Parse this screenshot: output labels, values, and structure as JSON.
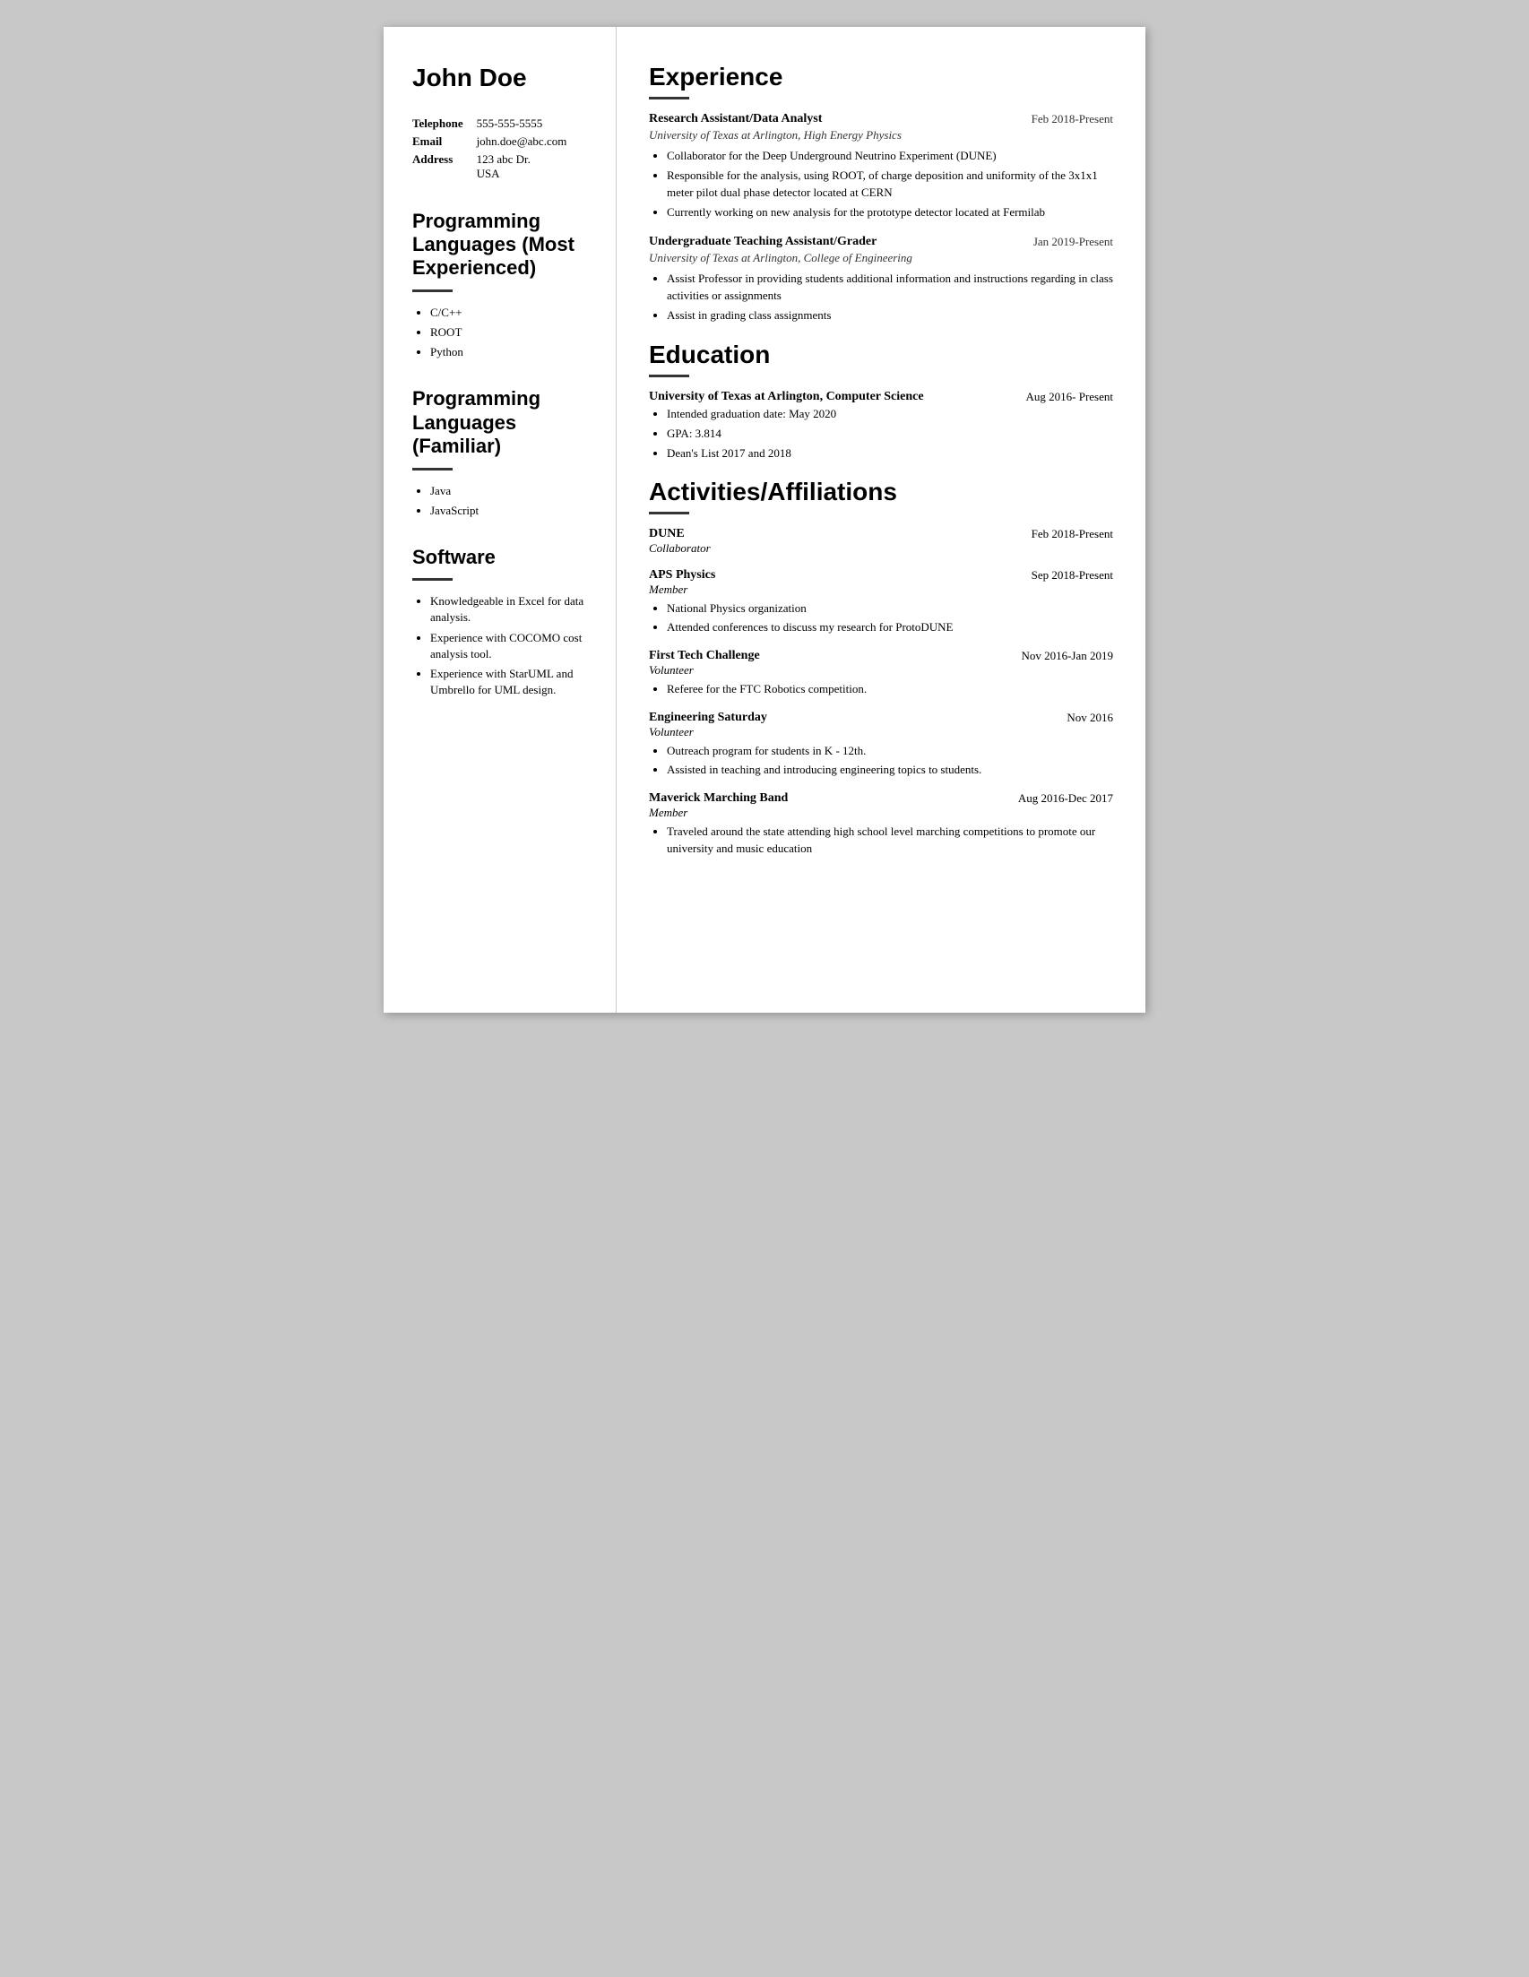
{
  "left": {
    "name": "John Doe",
    "contact": {
      "telephone_label": "Telephone",
      "telephone_value": "555-555-5555",
      "email_label": "Email",
      "email_value": "john.doe@abc.com",
      "address_label": "Address",
      "address_line1": "123 abc Dr.",
      "address_line2": "USA"
    },
    "prog_most_title": "Programming Languages (Most Experienced)",
    "prog_most_items": [
      "C/C++",
      "ROOT",
      "Python"
    ],
    "prog_familiar_title": "Programming Languages (Familiar)",
    "prog_familiar_items": [
      "Java",
      "JavaScript"
    ],
    "software_title": "Software",
    "software_items": [
      "Knowledgeable in Excel for data analysis.",
      "Experience with COCOMO cost analysis tool.",
      "Experience with StarUML and Umbrello for UML design."
    ]
  },
  "right": {
    "experience_title": "Experience",
    "jobs": [
      {
        "title": "Research Assistant/Data Analyst",
        "date": "Feb 2018-Present",
        "subtitle": "University of Texas at Arlington, High Energy Physics",
        "bullets": [
          "Collaborator for the Deep Underground Neutrino Experiment (DUNE)",
          "Responsible for the analysis, using ROOT, of charge deposition and uniformity of the 3x1x1 meter pilot dual phase detector located at CERN",
          "Currently working on new analysis for the prototype detector located at Fermilab"
        ]
      },
      {
        "title": "Undergraduate Teaching Assistant/Grader",
        "date": "Jan 2019-Present",
        "subtitle": "University of Texas at Arlington, College of Engineering",
        "bullets": [
          "Assist Professor in providing students additional information and instructions regarding in class activities or assignments",
          "Assist in grading class assignments"
        ]
      }
    ],
    "education_title": "Education",
    "education": [
      {
        "title": "University of Texas at Arlington, Computer Science",
        "date": "Aug 2016- Present",
        "bullets": [
          "Intended graduation date: May 2020",
          "GPA: 3.814",
          "Dean's List 2017 and 2018"
        ]
      }
    ],
    "activities_title": "Activities/Affiliations",
    "activities": [
      {
        "title": "DUNE",
        "date": "Feb 2018-Present",
        "subtitle": "Collaborator",
        "bullets": []
      },
      {
        "title": "APS Physics",
        "date": "Sep 2018-Present",
        "subtitle": "Member",
        "bullets": [
          "National Physics organization",
          "Attended conferences to discuss my research for ProtoDUNE"
        ]
      },
      {
        "title": "First Tech Challenge",
        "date": "Nov 2016-Jan 2019",
        "subtitle": "Volunteer",
        "bullets": [
          "Referee for the FTC Robotics competition."
        ]
      },
      {
        "title": "Engineering Saturday",
        "date": "Nov 2016",
        "subtitle": "Volunteer",
        "bullets": [
          "Outreach program for students in K - 12th.",
          "Assisted in teaching and introducing engineering topics to students."
        ]
      },
      {
        "title": "Maverick Marching Band",
        "date": "Aug 2016-Dec 2017",
        "subtitle": "Member",
        "bullets": [
          "Traveled around the state attending high school level marching competitions to promote our university and music education"
        ]
      }
    ]
  }
}
